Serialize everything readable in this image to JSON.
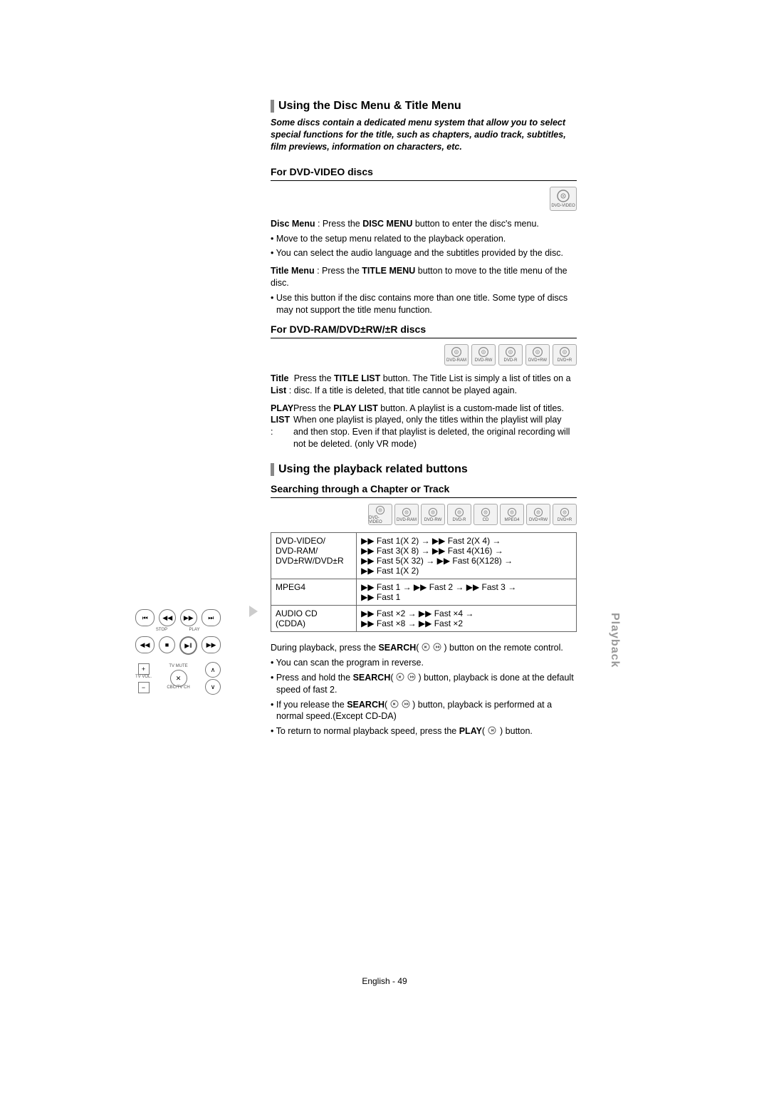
{
  "section1": {
    "title": "Using the Disc Menu & Title Menu",
    "intro": "Some discs contain a dedicated menu system that allow you to select special functions for the title, such as chapters, audio track, subtitles, film previews, information on characters, etc.",
    "sub1": {
      "heading": "For DVD-VIDEO discs",
      "discs": [
        "DVD-VIDEO"
      ],
      "disc_menu_label": "Disc Menu",
      "disc_menu_text": " : Press the ",
      "disc_menu_btn": "DISC MENU",
      "disc_menu_text2": " button to enter the disc's menu.",
      "b1": "• Move to the setup menu related to the playback operation.",
      "b2": "• You can select the audio language and the subtitles provided by the disc.",
      "title_menu_label": "Title Menu",
      "title_menu_text": " : Press the ",
      "title_menu_btn": "TITLE MENU",
      "title_menu_text2": " button to move to the title menu of the disc.",
      "b3": "• Use this button if the disc contains more than one title. Some type of discs may not support the title menu function."
    },
    "sub2": {
      "heading": "For DVD-RAM/DVD±RW/±R discs",
      "discs": [
        "DVD-RAM",
        "DVD-RW",
        "DVD-R",
        "DVD+RW",
        "DVD+R"
      ],
      "title_list_label": "Title List",
      "title_list_sep": " : ",
      "title_list_text": "Press the ",
      "title_list_btn": "TITLE LIST",
      "title_list_text2": " button. The Title List is simply a list of titles on a disc. If a title is deleted, that title cannot be played again.",
      "play_list_label": "PLAY LIST",
      "play_list_sep": " : ",
      "play_list_text": "Press the ",
      "play_list_btn": "PLAY LIST",
      "play_list_text2": " button. A playlist is a custom-made list of titles. When one playlist is played, only the titles within the playlist will play and then stop. Even if that playlist is deleted, the original recording will not be deleted. (only VR mode)"
    }
  },
  "section2": {
    "title": "Using the playback related buttons",
    "subhead": "Searching through a Chapter or Track",
    "discs": [
      "DVD-VIDEO",
      "DVD-RAM",
      "DVD-RW",
      "DVD-R",
      "CD",
      "MPEG4",
      "DVD+RW",
      "DVD+R"
    ],
    "table": {
      "r1c1": "DVD-VIDEO/\nDVD-RAM/\nDVD±RW/DVD±R",
      "r1c2": "▶▶ Fast 1(X 2) → ▶▶ Fast 2(X 4) →\n▶▶ Fast 3(X 8) → ▶▶ Fast 4(X16) →\n▶▶ Fast 5(X 32) → ▶▶ Fast 6(X128) →\n▶▶ Fast 1(X 2)",
      "r2c1": "MPEG4",
      "r2c2": "▶▶ Fast 1 → ▶▶ Fast 2 → ▶▶ Fast 3 →\n▶▶ Fast 1",
      "r3c1": "AUDIO CD\n(CDDA)",
      "r3c2": "▶▶ Fast ×2 → ▶▶ Fast ×4 →\n▶▶ Fast ×8 → ▶▶ Fast ×2"
    },
    "notes": {
      "p1a": "During playback, press the ",
      "p1b": "SEARCH",
      "p1c": "( ",
      "p1d": " ) button on the remote control.",
      "b1": "• You can scan the program in reverse.",
      "b2a": "• Press and hold the ",
      "b2b": "SEARCH",
      "b2c": "( ",
      "b2d": " ) button, playback is done at the default speed of fast 2.",
      "b3a": "• If you release the ",
      "b3b": "SEARCH",
      "b3c": "( ",
      "b3d": " ) button, playback is performed at a normal speed.(Except CD-DA)",
      "b4a": "• To return to normal playback speed, press the ",
      "b4b": "PLAY",
      "b4c": "( ",
      "b4d": " ) button."
    }
  },
  "remote": {
    "stop_lbl": "STOP",
    "play_lbl": "PLAY",
    "tvmute_lbl": "TV MUTE",
    "tvvol_lbl": "TV VOL.",
    "cbc_lbl": "CBC/TV CH"
  },
  "sidetab": "Playback",
  "footer": "English - 49"
}
